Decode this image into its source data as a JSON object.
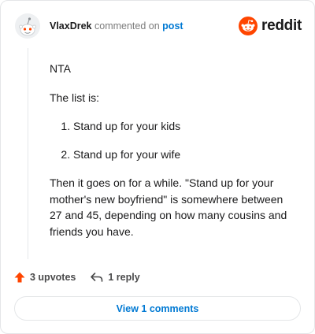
{
  "header": {
    "username": "VlaxDrek",
    "verb": "commented on",
    "post_link": "post",
    "brand": "reddit"
  },
  "comment": {
    "paragraph_1": "NTA",
    "paragraph_2": "The list is:",
    "list_items": [
      "Stand up for your kids",
      "Stand up for your wife"
    ],
    "paragraph_3": "Then it goes on for a while. \"Stand up for your mother's new boyfriend\" is somewhere between 27 and 45, depending on how many cousins and friends you have."
  },
  "actions": {
    "upvotes": "3 upvotes",
    "reply": "1 reply"
  },
  "view_comments_label": "View 1 comments",
  "colors": {
    "brand_orange": "#ff4500",
    "link_blue": "#0079d3"
  },
  "icons": {
    "upvote": "upvote-arrow-icon",
    "reply": "reply-arrow-icon",
    "brand": "reddit-snoo-icon"
  }
}
